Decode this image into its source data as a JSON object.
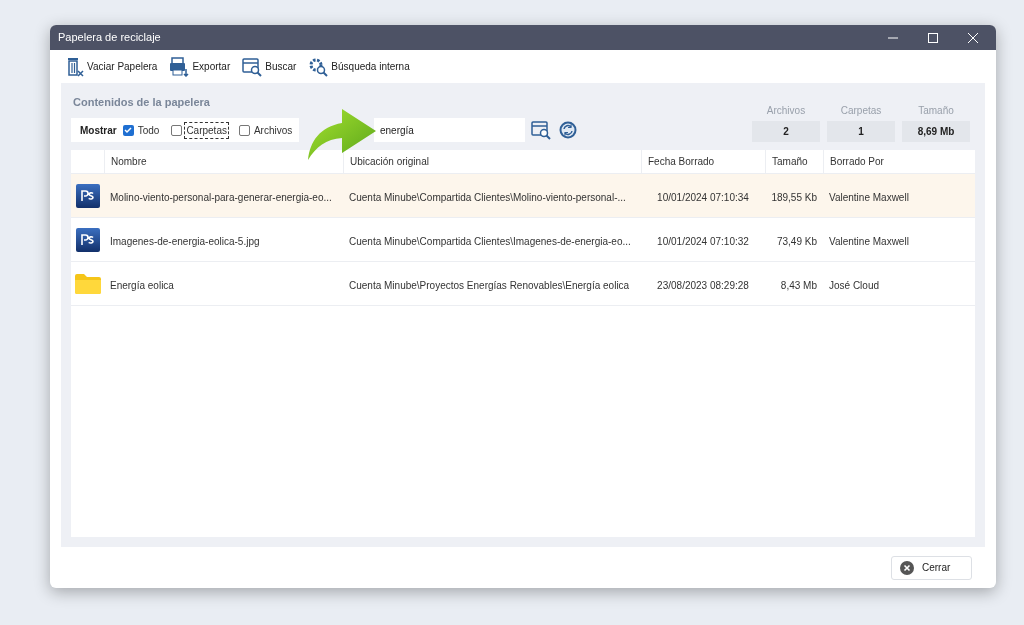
{
  "window": {
    "title": "Papelera de reciclaje"
  },
  "toolbar": [
    {
      "kind": "empty",
      "label": "Vaciar Papelera"
    },
    {
      "kind": "export",
      "label": "Exportar"
    },
    {
      "kind": "search",
      "label": "Buscar"
    },
    {
      "kind": "internal",
      "label": "Búsqueda interna"
    }
  ],
  "panel_title": "Contenidos de la papelera",
  "filter": {
    "label": "Mostrar",
    "options": [
      {
        "label": "Todo",
        "checked": true,
        "focused": false
      },
      {
        "label": "Carpetas",
        "checked": false,
        "focused": true
      },
      {
        "label": "Archivos",
        "checked": false,
        "focused": false
      }
    ]
  },
  "search": {
    "value": "energía"
  },
  "stats": [
    {
      "label": "Archivos",
      "value": "2"
    },
    {
      "label": "Carpetas",
      "value": "1"
    },
    {
      "label": "Tamaño",
      "value": "8,69 Mb"
    }
  ],
  "table": {
    "columns": [
      "Nombre",
      "Ubicación original",
      "Fecha Borrado",
      "Tamaño",
      "Borrado Por"
    ],
    "rows": [
      {
        "kind": "psd",
        "selected": true,
        "cells": [
          "Molino-viento-personal-para-generar-energia-eo...",
          "Cuenta Minube\\Compartida Clientes\\Molino-viento-personal-...",
          "10/01/2024 07:10:34",
          "189,55 Kb",
          "Valentine Maxwell"
        ]
      },
      {
        "kind": "psd",
        "selected": false,
        "cells": [
          "Imagenes-de-energia-eolica-5.jpg",
          "Cuenta Minube\\Compartida Clientes\\Imagenes-de-energia-eo...",
          "10/01/2024 07:10:32",
          "73,49 Kb",
          "Valentine Maxwell"
        ]
      },
      {
        "kind": "folder",
        "selected": false,
        "cells": [
          "Energía eolica",
          "Cuenta Minube\\Proyectos Energías Renovables\\Energía eolica",
          "23/08/2023 08:29:28",
          "8,43 Mb",
          "José Cloud"
        ]
      }
    ]
  },
  "close_button": {
    "label": "Cerrar"
  }
}
